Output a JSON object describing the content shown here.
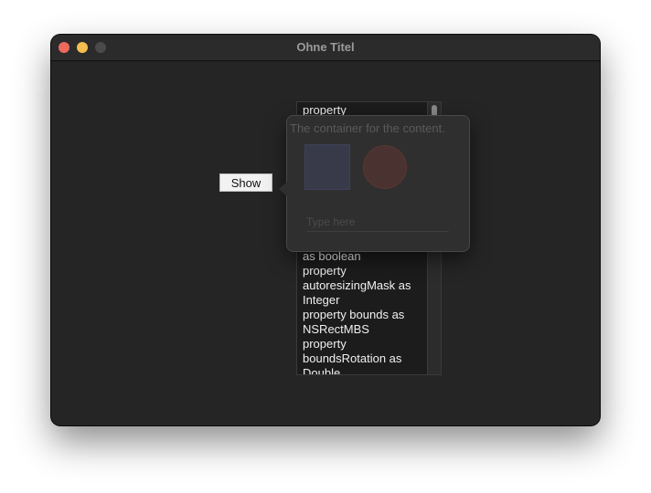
{
  "window": {
    "title": "Ohne Titel"
  },
  "button": {
    "show_label": "Show"
  },
  "popover": {
    "label": "The container for the content.",
    "input_placeholder": "Type here"
  },
  "list": {
    "top_lines": [
      "property"
    ],
    "bottom_lines": [
      "as boolean",
      "property",
      "autoresizingMask as",
      "Integer",
      "property bounds as",
      "NSRectMBS",
      "property",
      "boundsRotation as",
      "Double"
    ]
  },
  "colors": {
    "window_bg": "#252525",
    "square_fill": "#383a4a",
    "circle_fill": "#4a3230"
  }
}
